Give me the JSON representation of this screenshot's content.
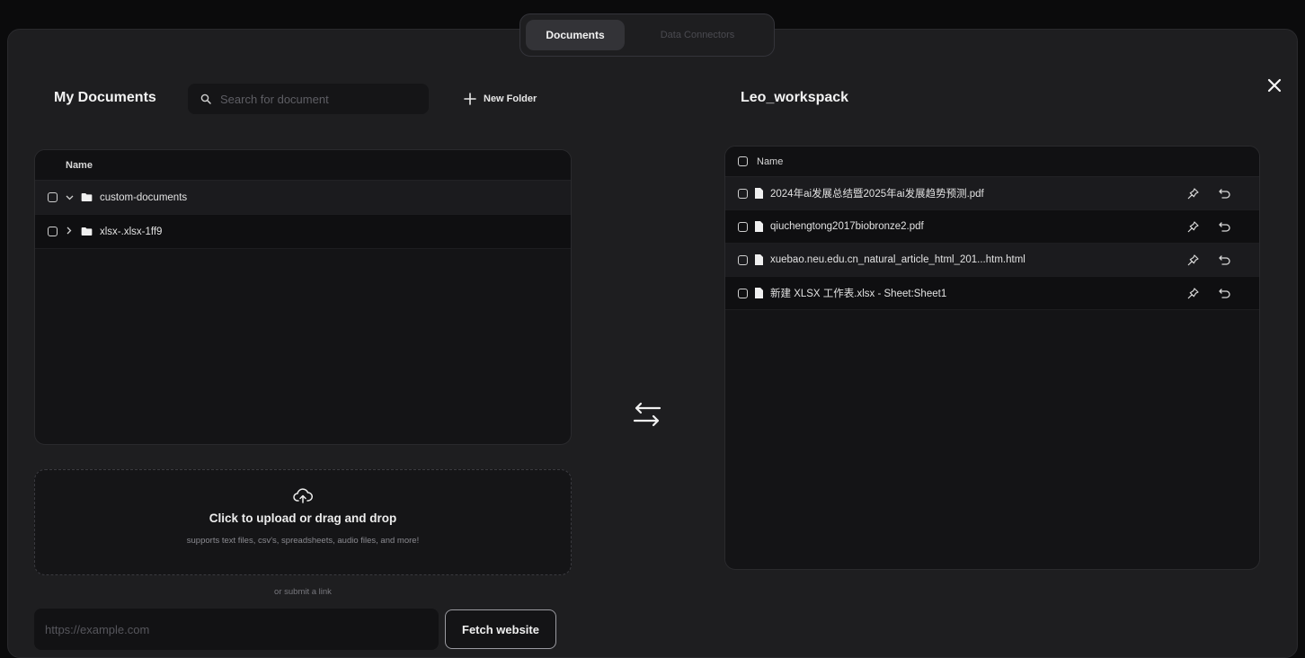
{
  "tabs": [
    {
      "label": "Documents",
      "active": true
    },
    {
      "label": "Data Connectors",
      "active": false
    }
  ],
  "close_icon": "close-icon",
  "left": {
    "title": "My Documents",
    "search_placeholder": "Search for document",
    "new_folder_label": "New Folder",
    "column_name": "Name",
    "folders": [
      {
        "name": "custom-documents",
        "expanded": true
      },
      {
        "name": "xlsx-.xlsx-1ff9",
        "expanded": false
      }
    ]
  },
  "upload": {
    "title": "Click to upload or drag and drop",
    "subtitle": "supports text files, csv's, spreadsheets, audio files, and more!",
    "or_link": "or submit a link",
    "url_placeholder": "https://example.com",
    "fetch_label": "Fetch website"
  },
  "right": {
    "title": "Leo_workspack",
    "column_name": "Name",
    "files": [
      {
        "name": "2024年ai发展总结暨2025年ai发展趋势预测.pdf"
      },
      {
        "name": "qiuchengtong2017biobronze2.pdf"
      },
      {
        "name": "xuebao.neu.edu.cn_natural_article_html_201...htm.html"
      },
      {
        "name": "新建 XLSX 工作表.xlsx - Sheet:Sheet1"
      }
    ]
  },
  "colors": {
    "background": "#0b0b0c",
    "modal": "#1e1e20",
    "panel": "#141416",
    "text": "#e6e6e6"
  }
}
